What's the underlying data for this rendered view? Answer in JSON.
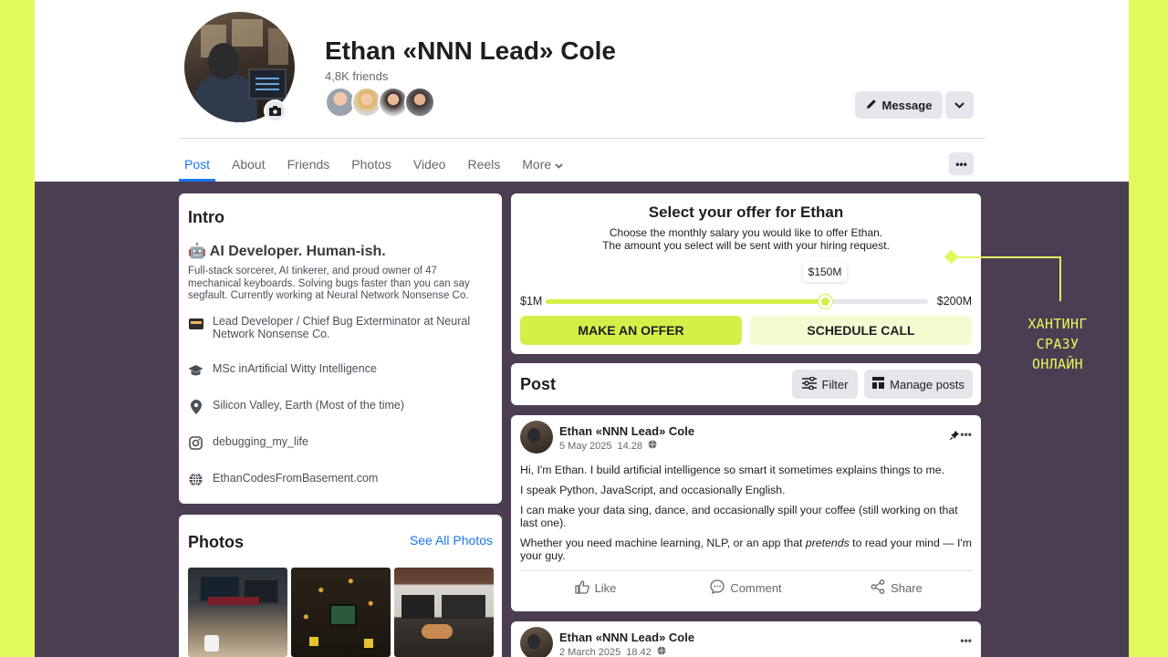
{
  "profile": {
    "name": "Ethan «NNN Lead» Cole",
    "friends_count": "4,8K friends",
    "message_label": "Message"
  },
  "tabs": [
    "Post",
    "About",
    "Friends",
    "Photos",
    "Video",
    "Reels",
    "More"
  ],
  "intro": {
    "title": "Intro",
    "headline": "🤖 AI Developer. Human-ish.",
    "bio": "Full-stack sorcerer, AI tinkerer, and proud owner of 47 mechanical keyboards. Solving bugs faster than you can say segfault. Currently working at Neural Network Nonsense Co.",
    "work": "Lead Developer / Chief Bug Exterminator at Neural Network Nonsense Co.",
    "education": "MSc inArtificial Witty Intelligence",
    "location": "Silicon Valley, Earth (Most of the time)",
    "instagram": "debugging_my_life",
    "website": "EthanCodesFromBasement.com"
  },
  "photos": {
    "title": "Photos",
    "see_all": "See All Photos"
  },
  "offer": {
    "title": "Select your offer for Ethan",
    "subtitle_1": "Choose the monthly salary you would like to offer Ethan.",
    "subtitle_2": "The amount you select will be sent with your hiring request.",
    "min_label": "$1M",
    "max_label": "$200M",
    "value_label": "$150M",
    "slider_fraction": 0.73,
    "offer_button": "MAKE AN OFFER",
    "call_button": "SCHEDULE CALL"
  },
  "post_section": {
    "title": "Post",
    "filter": "Filter",
    "manage": "Manage posts"
  },
  "posts": [
    {
      "author": "Ethan «NNN Lead» Cole",
      "date": "5 May 2025",
      "time": "14.28",
      "lines": [
        "Hi, I'm Ethan. I build artificial intelligence so smart it sometimes explains things to me.",
        "I speak Python, JavaScript, and occasionally English.",
        "I can make your data sing, dance, and occasionally spill your coffee (still working on that last one)."
      ],
      "last_line_pre": "Whether you need machine learning, NLP, or an app that ",
      "last_line_em": "pretends",
      "last_line_post": " to read your mind — I'm your guy.",
      "like": "Like",
      "comment": "Comment",
      "share": "Share"
    },
    {
      "author": "Ethan «NNN Lead» Cole",
      "date": "2 March 2025",
      "time": "18.42"
    }
  ],
  "annotation": {
    "line1": "ХАНТИНГ",
    "line2": "СРАЗУ",
    "line3": "ОНЛАЙН"
  },
  "colors": {
    "accent": "#d4ef48",
    "background_side": "#e2f95b",
    "feed_bg": "#4b3e53",
    "link": "#1877f2"
  }
}
